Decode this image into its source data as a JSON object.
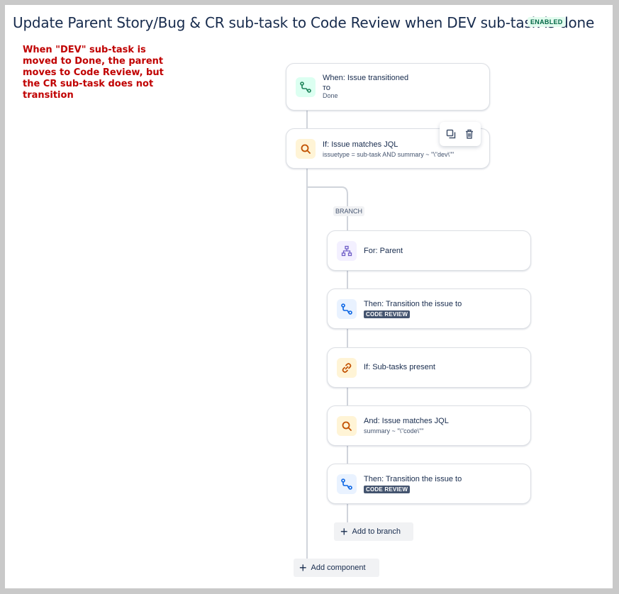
{
  "rule": {
    "title": "Update Parent Story/Bug & CR sub-task to Code Review when DEV sub-task is done",
    "status": "ENABLED"
  },
  "annotation": {
    "text": "When \"DEV\" sub-task is moved to Done, the parent moves to Code Review, but the CR sub-task does not transition"
  },
  "components": {
    "trigger": {
      "title": "When: Issue transitioned",
      "to_label": "TO",
      "to_value": "Done",
      "icon": "transition-icon"
    },
    "condition": {
      "title": "If: Issue matches JQL",
      "jql": "issuetype = sub-task AND summary ~ \"\\\"dev\\\"\"",
      "icon": "search-icon"
    },
    "toolbar": {
      "copy_icon": "copy-icon",
      "delete_icon": "trash-icon"
    }
  },
  "branch": {
    "label": "BRANCH",
    "items": [
      {
        "title": "For: Parent",
        "icon": "hierarchy-icon"
      },
      {
        "title": "Then: Transition the issue to",
        "status": "CODE REVIEW",
        "icon": "transition-icon"
      },
      {
        "title": "If: Sub-tasks present",
        "icon": "link-icon"
      },
      {
        "title": "And: Issue matches JQL",
        "jql": "summary ~ \"\\\"code\\\"\"",
        "icon": "search-icon"
      },
      {
        "title": "Then: Transition the issue to",
        "status": "CODE REVIEW",
        "icon": "transition-icon"
      }
    ],
    "add_label": "Add to branch"
  },
  "add_component_label": "Add component",
  "colors": {
    "annotation": "#c00000",
    "enabled_badge_bg": "#e3fcef",
    "enabled_badge_text": "#006644",
    "status_lozenge": "#44546f"
  }
}
